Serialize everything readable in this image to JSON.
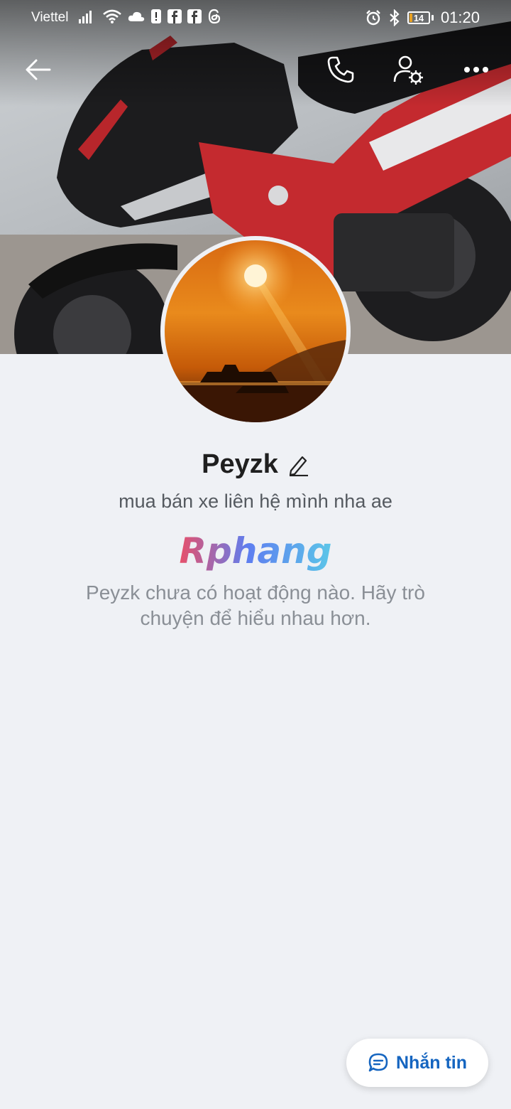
{
  "status_bar": {
    "carrier": "Viettel",
    "battery_level": "14",
    "time": "01:20",
    "icons": [
      "signal-icon",
      "wifi-icon",
      "cloud-icon",
      "notification-icon",
      "facebook-icon",
      "facebook-icon",
      "threads-icon",
      "alarm-icon",
      "bluetooth-icon",
      "battery-icon"
    ]
  },
  "header": {
    "icons": [
      "back-arrow-icon",
      "phone-icon",
      "user-settings-icon",
      "more-icon"
    ]
  },
  "profile": {
    "name": "Peyzk",
    "bio": "mua bán xe liên hệ mình nha ae",
    "watermark_text": "Rphang",
    "empty_activity_text": "Peyzk chưa có hoạt động nào. Hãy trò chuyện để hiểu nhau hơn."
  },
  "message_button": {
    "label": "Nhắn tin",
    "icon": "chat-bubble-icon"
  },
  "colors": {
    "background": "#eff1f5",
    "accent": "#1565c0",
    "battery_fill": "#e8a020"
  }
}
